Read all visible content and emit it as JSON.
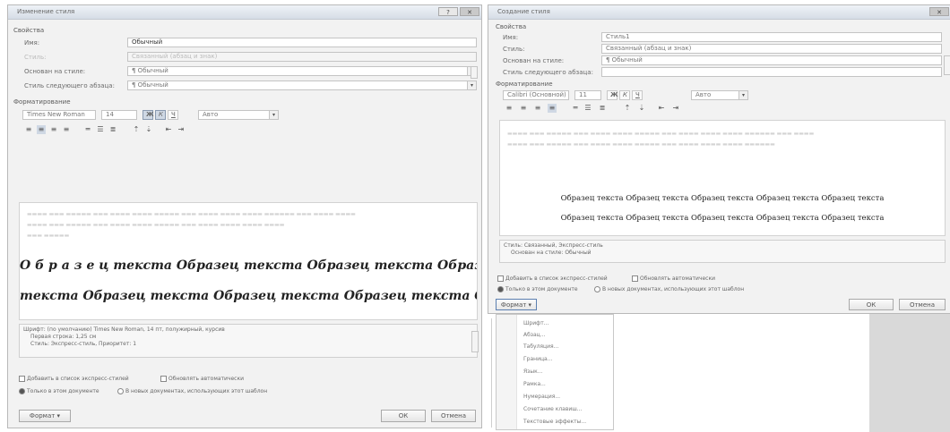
{
  "left": {
    "title": "Изменение стиля",
    "close": "✕",
    "props_header": "Свойства",
    "name_label": "Имя:",
    "name_value": "Обычный",
    "style_label": "Стиль:",
    "style_value": "Связанный (абзац и знак)",
    "based_label": "Основан на стиле:",
    "based_value": "¶ Обычный",
    "next_label": "Стиль следующего абзаца:",
    "next_value": "¶ Обычный",
    "format_header": "Форматирование",
    "font": "Times New Roman",
    "size": "14",
    "bold": "Ж",
    "italic": "К",
    "underline": "Ч",
    "lang": "Авто",
    "sample_line1": "О б р а з е ц  текста Образец текста Образец текста Образец",
    "sample_line2": "текста Образец текста Образец текста Образец текста Образец",
    "desc_line1": "Шрифт: (по умолчанию) Times New Roman, 14 пт, полужирный, курсив",
    "desc_line2": "Первая строка: 1,25 см",
    "desc_line3": "Стиль: Экспресс-стиль, Приоритет: 1",
    "add_to_quick": "Добавить в список экспресс-стилей",
    "auto_update": "Обновлять автоматически",
    "only_this_doc": "Только в этом документе",
    "new_docs": "В новых документах, использующих этот шаблон",
    "format_btn": "Формат ▾",
    "ok": "ОК",
    "cancel": "Отмена"
  },
  "right": {
    "title": "Создание стиля",
    "props_header": "Свойства",
    "name_label": "Имя:",
    "name_value": "Стиль1",
    "style_label": "Стиль:",
    "style_value": "Связанный (абзац и знак)",
    "based_label": "Основан на стиле:",
    "based_value": "¶ Обычный",
    "next_label": "Стиль следующего абзаца:",
    "next_value": "",
    "format_header": "Форматирование",
    "font": "Calibri (Основной)",
    "size": "11",
    "bold": "Ж",
    "italic": "К",
    "underline": "Ч",
    "lang": "Авто",
    "sample_line1": "Образец текста Образец текста Образец текста Образец текста Образец текста",
    "sample_line2": "Образец текста Образец текста Образец текста Образец текста Образец текста",
    "desc_line1": "Стиль: Связанный, Экспресс-стиль",
    "desc_line2": "Основан на стиле: Обычный",
    "add_to_quick": "Добавить в список экспресс-стилей",
    "auto_update": "Обновлять автоматически",
    "only_this_doc": "Только в этом документе",
    "new_docs": "В новых документах, использующих этот шаблон",
    "format_btn": "Формат ▾",
    "ok": "ОК",
    "cancel": "Отмена"
  },
  "menu": {
    "items": [
      "Шрифт...",
      "Абзац...",
      "Табуляция...",
      "Граница...",
      "Язык...",
      "Рамка...",
      "Нумерация...",
      "Сочетание клавиш...",
      "Текстовые эффекты..."
    ]
  }
}
